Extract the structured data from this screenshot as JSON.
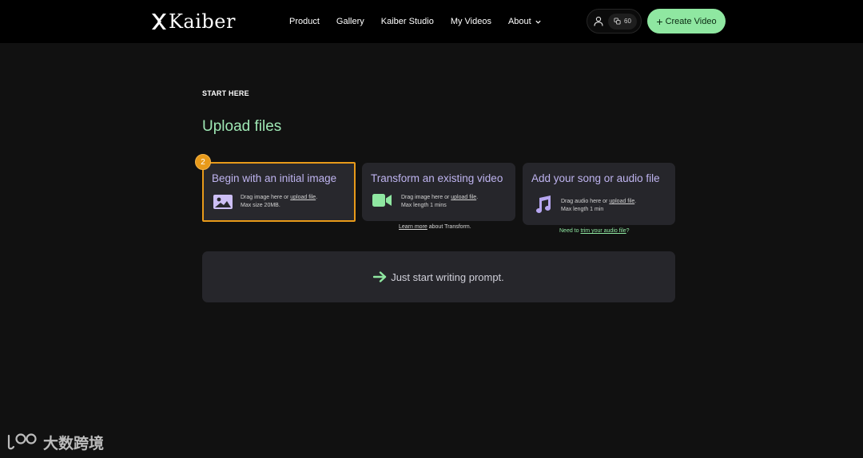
{
  "header": {
    "logo_text": "Kaiber",
    "nav": [
      {
        "label": "Product"
      },
      {
        "label": "Gallery"
      },
      {
        "label": "Kaiber Studio"
      },
      {
        "label": "My Videos"
      },
      {
        "label": "About"
      }
    ],
    "credits": "60",
    "create_label": "Create Video"
  },
  "main": {
    "eyebrow": "START HERE",
    "title": "Upload files",
    "step_number": "2",
    "cards": [
      {
        "title": "Begin with an initial image",
        "line1_prefix": "Drag image here or ",
        "line1_link": "upload file",
        "line1_suffix": ".",
        "line2": "Max size 20MB.",
        "icon": "image-icon"
      },
      {
        "title": "Transform an existing video",
        "line1_prefix": "Drag image here or ",
        "line1_link": "upload file",
        "line1_suffix": ".",
        "line2": "Max length 1 mins",
        "icon": "video-camera-icon"
      },
      {
        "title": "Add your song or audio file",
        "line1_prefix": "Drag audio here or ",
        "line1_link": "upload file",
        "line1_suffix": ".",
        "line2": "Max length 1 min",
        "icon": "music-note-icon"
      }
    ],
    "video_helper": {
      "link": "Learn more",
      "suffix": " about Transform."
    },
    "audio_helper": {
      "prefix": "Need to ",
      "link": "trim your audio file",
      "suffix": "?"
    },
    "prompt_label": "Just start writing prompt."
  },
  "watermark": {
    "text": "大数跨境"
  },
  "colors": {
    "accent_green": "#8fe7a1",
    "title_green": "#9ee7b4",
    "card_title_purple": "#bfb4f0",
    "active_border": "#e89a1a",
    "card_bg": "#26262b"
  }
}
